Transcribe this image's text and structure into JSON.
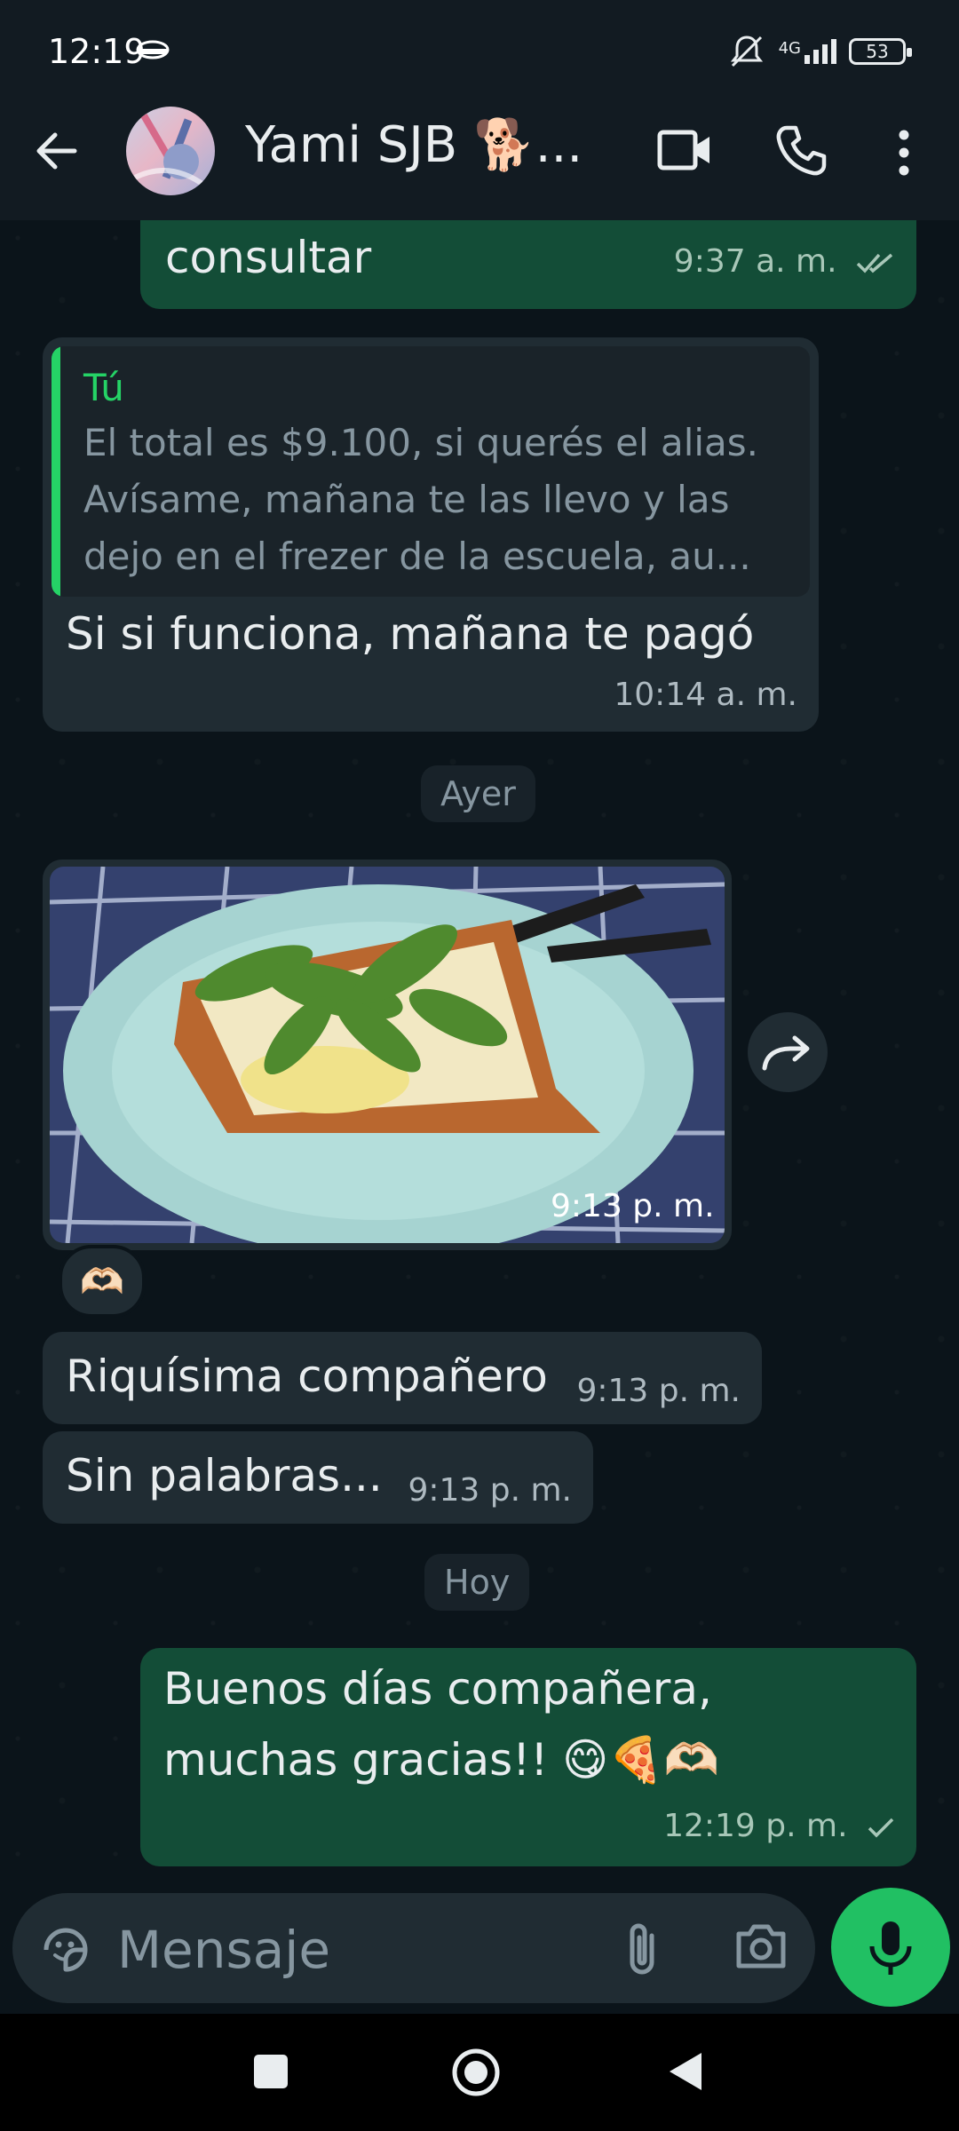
{
  "status_bar": {
    "time": "12:19",
    "network": "4G",
    "battery": "53"
  },
  "header": {
    "contact_name": "Yami SJB 🐕...",
    "avatar_icon": "contact-avatar",
    "back_icon": "arrow-left-icon",
    "video_icon": "video-camera-icon",
    "call_icon": "phone-icon",
    "menu_icon": "more-vertical-icon"
  },
  "messages": [
    {
      "type": "outgoing",
      "text": "consultar",
      "time": "9:37 a. m.",
      "status": "read"
    },
    {
      "type": "incoming",
      "quote": {
        "author": "Tú",
        "lines": [
          "El total es $9.100, si querés el alias.",
          "Avísame, mañana te las llevo y las",
          "dejo en el frezer de la escuela, au..."
        ]
      },
      "text": "Si si funciona, mañana te pagó",
      "time": "10:14 a. m."
    },
    {
      "type": "date",
      "text": "Ayer"
    },
    {
      "type": "incoming-image",
      "time": "9:13 p. m.",
      "reaction": "🫶🏻",
      "image": "pizza slice with arugula on light blue plate"
    },
    {
      "type": "incoming",
      "text": "Riquísima compañero",
      "time": "9:13 p. m."
    },
    {
      "type": "incoming",
      "text": "Sin palabras...",
      "time": "9:13 p. m."
    },
    {
      "type": "date",
      "text": "Hoy"
    },
    {
      "type": "outgoing",
      "text_lines": [
        "Buenos días compañera,",
        "muchas gracias!! 😋🍕🫶🏻"
      ],
      "time": "12:19 p. m.",
      "status": "sent"
    }
  ],
  "input_bar": {
    "placeholder": "Mensaje",
    "sticker_icon": "sticker-icon",
    "attach_icon": "paperclip-icon",
    "camera_icon": "camera-icon",
    "mic_icon": "microphone-icon"
  },
  "colors": {
    "background": "#0b141a",
    "outgoing_bubble": "#134d37",
    "incoming_bubble": "#202c33",
    "accent": "#25d366",
    "mic_button": "#21c063"
  }
}
